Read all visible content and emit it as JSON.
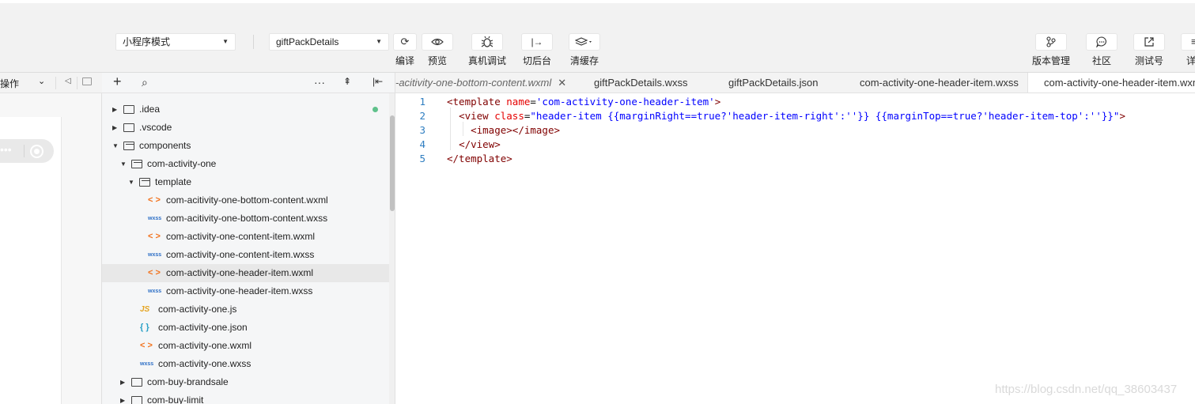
{
  "toolbar": {
    "mode_select": "小程序模式",
    "page_select": "giftPackDetails",
    "buttons": {
      "compile": {
        "icon": "refresh-icon",
        "label": "编译"
      },
      "preview": {
        "icon": "eye-icon",
        "label": "预览"
      },
      "remote_debug": {
        "icon": "bug-icon",
        "label": "真机调试"
      },
      "background": {
        "icon": "switch-background-icon",
        "label": "切后台"
      },
      "clear_cache": {
        "icon": "layers-icon",
        "label": "清缓存"
      },
      "version": {
        "icon": "branch-icon",
        "label": "版本管理"
      },
      "community": {
        "icon": "chat-icon",
        "label": "社区"
      },
      "test_account": {
        "icon": "share-icon",
        "label": "测试号"
      },
      "details": {
        "label": "详"
      }
    }
  },
  "simulator": {
    "operate_label": "操作"
  },
  "explorer": {
    "tree": [
      {
        "name": ".idea",
        "kind": "folder",
        "open": false,
        "depth": 0,
        "git": "new"
      },
      {
        "name": ".vscode",
        "kind": "folder",
        "open": false,
        "depth": 0
      },
      {
        "name": "components",
        "kind": "folder",
        "open": true,
        "depth": 0
      },
      {
        "name": "com-activity-one",
        "kind": "folder",
        "open": true,
        "depth": 1
      },
      {
        "name": "template",
        "kind": "folder",
        "open": true,
        "depth": 2
      },
      {
        "name": "com-acitivity-one-bottom-content.wxml",
        "kind": "wxml",
        "depth": 3
      },
      {
        "name": "com-acitivity-one-bottom-content.wxss",
        "kind": "wxss",
        "depth": 3
      },
      {
        "name": "com-activity-one-content-item.wxml",
        "kind": "wxml",
        "depth": 3
      },
      {
        "name": "com-activity-one-content-item.wxss",
        "kind": "wxss",
        "depth": 3
      },
      {
        "name": "com-activity-one-header-item.wxml",
        "kind": "wxml",
        "depth": 3,
        "selected": true
      },
      {
        "name": "com-activity-one-header-item.wxss",
        "kind": "wxss",
        "depth": 3
      },
      {
        "name": "com-activity-one.js",
        "kind": "js",
        "depth": 2
      },
      {
        "name": "com-activity-one.json",
        "kind": "json",
        "depth": 2
      },
      {
        "name": "com-activity-one.wxml",
        "kind": "wxml",
        "depth": 2
      },
      {
        "name": "com-activity-one.wxss",
        "kind": "wxss",
        "depth": 2
      },
      {
        "name": "com-buy-brandsale",
        "kind": "folder",
        "open": false,
        "depth": 1
      },
      {
        "name": "com-buy-limit",
        "kind": "folder",
        "open": false,
        "depth": 1
      }
    ],
    "file_glyphs": {
      "wxml": "< >",
      "wxss": "wxss",
      "js": "JS",
      "json": "{ }"
    }
  },
  "editor": {
    "tabs": [
      {
        "label": "-acitivity-one-bottom-content.wxml",
        "italic": true,
        "close": "✕"
      },
      {
        "label": "giftPackDetails.wxss"
      },
      {
        "label": "giftPackDetails.json"
      },
      {
        "label": "com-activity-one-header-item.wxss"
      },
      {
        "label": "com-activity-one-header-item.wxml",
        "active": true
      }
    ],
    "lines": [
      {
        "n": "1",
        "tokens": [
          [
            "tag",
            "<template "
          ],
          [
            "attr",
            "name"
          ],
          [
            "",
            "="
          ],
          [
            "str",
            "'com-activity-one-header-item'"
          ],
          [
            "tag",
            ">"
          ]
        ]
      },
      {
        "n": "2",
        "tokens": [
          [
            "",
            "  "
          ],
          [
            "tag",
            "<view "
          ],
          [
            "attr",
            "class"
          ],
          [
            "",
            "="
          ],
          [
            "str",
            "\"header-item {{marginRight==true?'header-item-right':''}} {{marginTop==true?'header-item-top':''}}\""
          ],
          [
            "tag",
            ">"
          ]
        ]
      },
      {
        "n": "3",
        "tokens": [
          [
            "",
            "    "
          ],
          [
            "tag",
            "<image></image>"
          ]
        ]
      },
      {
        "n": "4",
        "tokens": [
          [
            "",
            "  "
          ],
          [
            "tag",
            "</view>"
          ]
        ]
      },
      {
        "n": "5",
        "tokens": [
          [
            "tag",
            "</template>"
          ]
        ]
      }
    ]
  },
  "watermark": "https://blog.csdn.net/qq_38603437"
}
